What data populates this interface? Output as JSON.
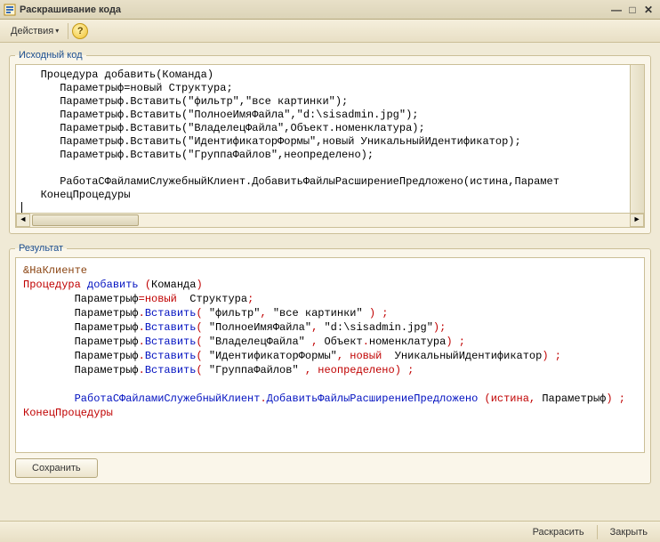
{
  "window": {
    "title": "Раскрашивание кода"
  },
  "toolbar": {
    "actions_label": "Действия"
  },
  "source": {
    "legend": "Исходный код",
    "lines": [
      "   Процедура добавить(Команда)",
      "      Параметрыф=новый Структура;",
      "      Параметрыф.Вставить(\"фильтр\",\"все картинки\");",
      "      Параметрыф.Вставить(\"ПолноеИмяФайла\",\"d:\\sisadmin.jpg\");",
      "      Параметрыф.Вставить(\"ВладелецФайла\",Объект.номенклатура);",
      "      Параметрыф.Вставить(\"ИдентификаторФормы\",новый УникальныйИдентификатор);",
      "      Параметрыф.Вставить(\"ГруппаФайлов\",неопределено);",
      "",
      "      РаботаСФайламиСлужебныйКлиент.ДобавитьФайлыРасширениеПредложено(истина,Парамет",
      "   КонецПроцедуры"
    ]
  },
  "result": {
    "legend": "Результат",
    "directive": "&НаКлиенте",
    "proc_kw": "Процедура",
    "proc_name": "добавить",
    "proc_arg": "Команда",
    "endproc": "КонецПроцедуры",
    "body": {
      "p": "Параметрыф",
      "new": "новый",
      "struct": "Структура",
      "ins": "Вставить",
      "l1_s1": "\"фильтр\"",
      "l1_s2": "\"все картинки\"",
      "l2_s1": "\"ПолноеИмяФайла\"",
      "l2_s2": "\"d:\\sisadmin.jpg\"",
      "l3_s1": "\"ВладелецФайла\"",
      "l3_obj": "Объект",
      "l3_prop": "номенклатура",
      "l4_s1": "\"ИдентификаторФормы\"",
      "l4_id": "УникальныйИдентификатор",
      "l5_s1": "\"ГруппаФайлов\"",
      "l5_undef": "неопределено",
      "call_obj": "РаботаСФайламиСлужебныйКлиент",
      "call_m": "ДобавитьФайлыРасширениеПредложено",
      "true": "истина"
    }
  },
  "buttons": {
    "save": "Сохранить",
    "colorize": "Раскрасить",
    "close": "Закрыть"
  }
}
